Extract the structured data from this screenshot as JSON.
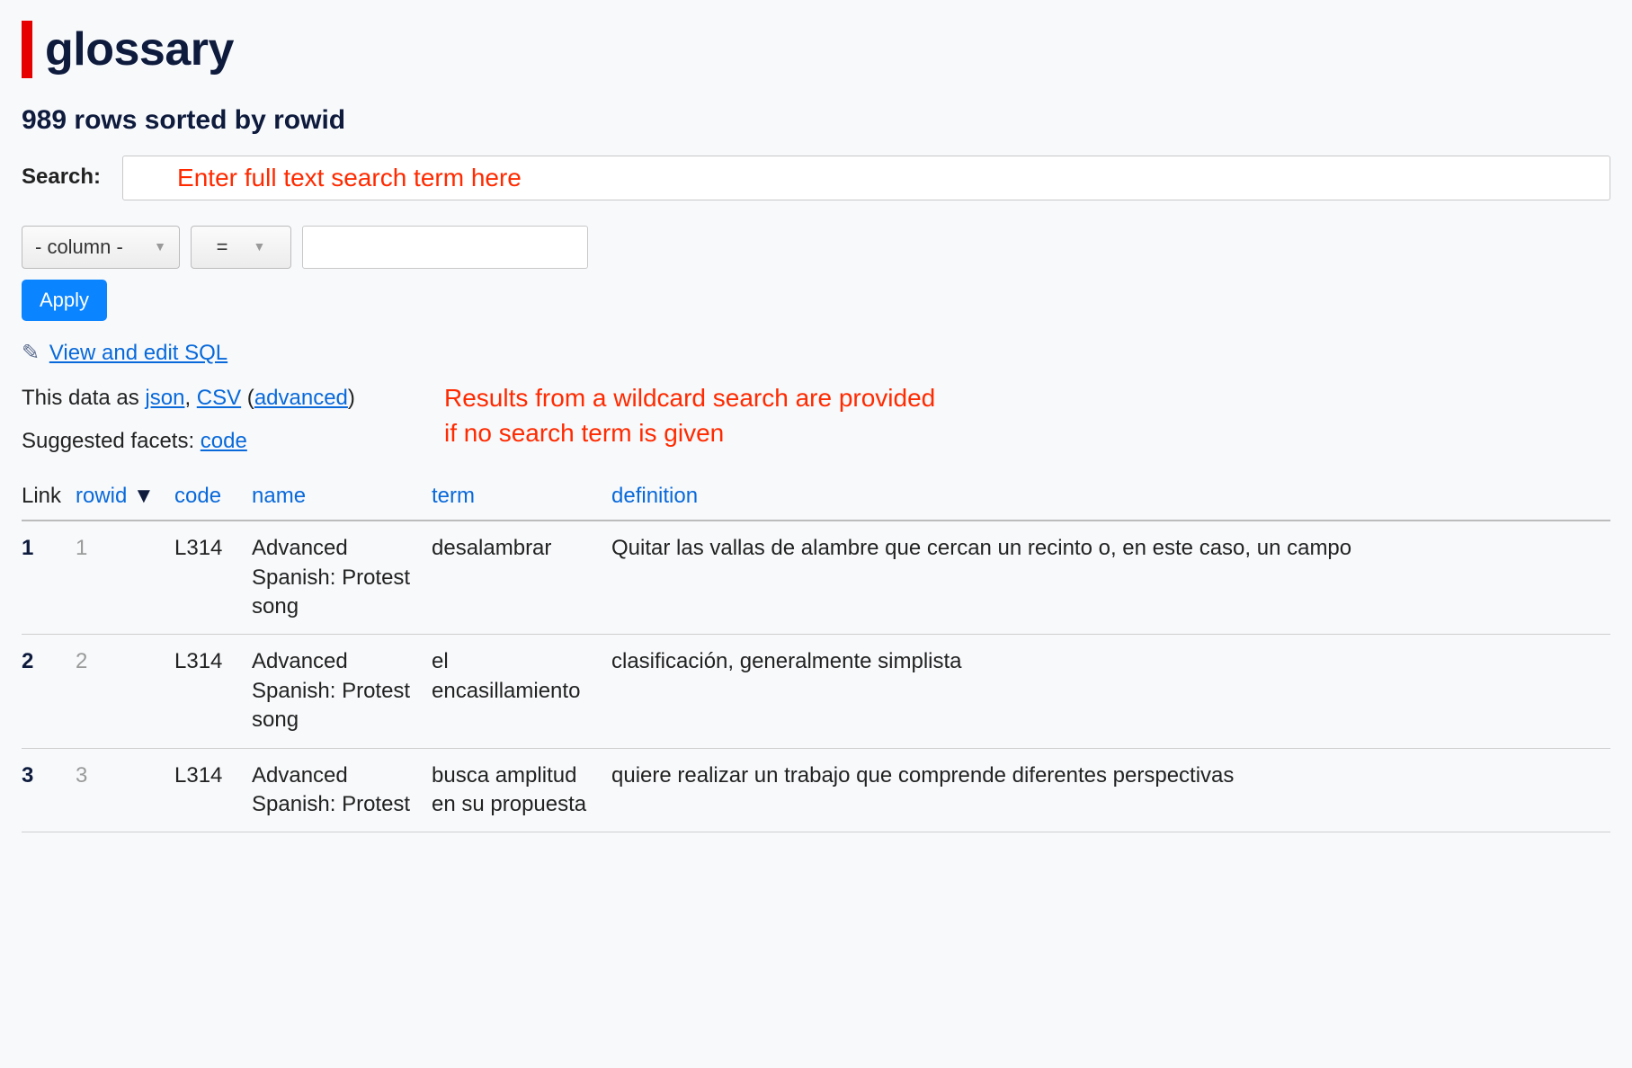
{
  "title": "glossary",
  "subtitle": "989 rows sorted by rowid",
  "search": {
    "label": "Search:",
    "value": "Enter full text search term here"
  },
  "filter": {
    "column_placeholder": "- column -",
    "operator": "=",
    "value": ""
  },
  "apply_label": "Apply",
  "sql_link": "View and edit SQL",
  "export": {
    "prefix": "This data as ",
    "json": "json",
    "sep": ", ",
    "csv": "CSV",
    "open_paren": " (",
    "advanced": "advanced",
    "close_paren": ")"
  },
  "facets": {
    "label": "Suggested facets: ",
    "code": "code"
  },
  "annotation": "Results from a wildcard search are provided if no search term is given",
  "columns": {
    "link": "Link",
    "rowid": "rowid",
    "sort_indicator": "▼",
    "code": "code",
    "name": "name",
    "term": "term",
    "definition": "definition"
  },
  "rows": [
    {
      "link": "1",
      "rowid": "1",
      "code": "L314",
      "name": "Advanced Spanish: Protest song",
      "term": "desalambrar",
      "definition": "Quitar las vallas de alambre que cercan un recinto o, en este caso, un campo"
    },
    {
      "link": "2",
      "rowid": "2",
      "code": "L314",
      "name": "Advanced Spanish: Protest song",
      "term": "el encasillamiento",
      "definition": "clasificación, generalmente simplista"
    },
    {
      "link": "3",
      "rowid": "3",
      "code": "L314",
      "name": "Advanced Spanish: Protest",
      "term": "busca amplitud en su propuesta",
      "definition": "quiere realizar un trabajo que comprende diferentes perspectivas"
    }
  ]
}
